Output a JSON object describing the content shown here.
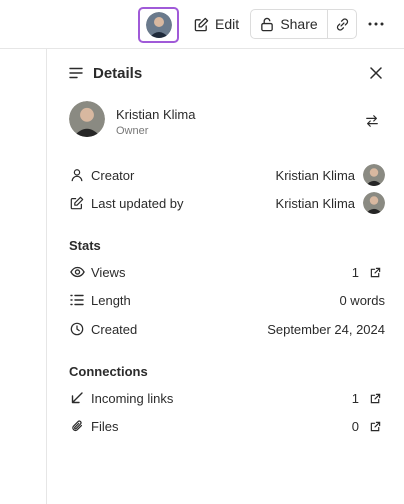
{
  "toolbar": {
    "edit_label": "Edit",
    "share_label": "Share"
  },
  "details": {
    "title": "Details",
    "owner": {
      "name": "Kristian Klima",
      "role": "Owner"
    },
    "creator": {
      "label": "Creator",
      "value": "Kristian Klima"
    },
    "last_updated": {
      "label": "Last updated by",
      "value": "Kristian Klima"
    },
    "stats": {
      "heading": "Stats",
      "views": {
        "label": "Views",
        "value": "1"
      },
      "length": {
        "label": "Length",
        "value": "0 words"
      },
      "created": {
        "label": "Created",
        "value": "September 24, 2024"
      }
    },
    "connections": {
      "heading": "Connections",
      "incoming": {
        "label": "Incoming links",
        "value": "1"
      },
      "files": {
        "label": "Files",
        "value": "0"
      }
    }
  },
  "colors": {
    "focus_ring": "#a05ad8",
    "border": "#e6e6e6",
    "text": "#2b2b2b",
    "muted": "#777777"
  }
}
